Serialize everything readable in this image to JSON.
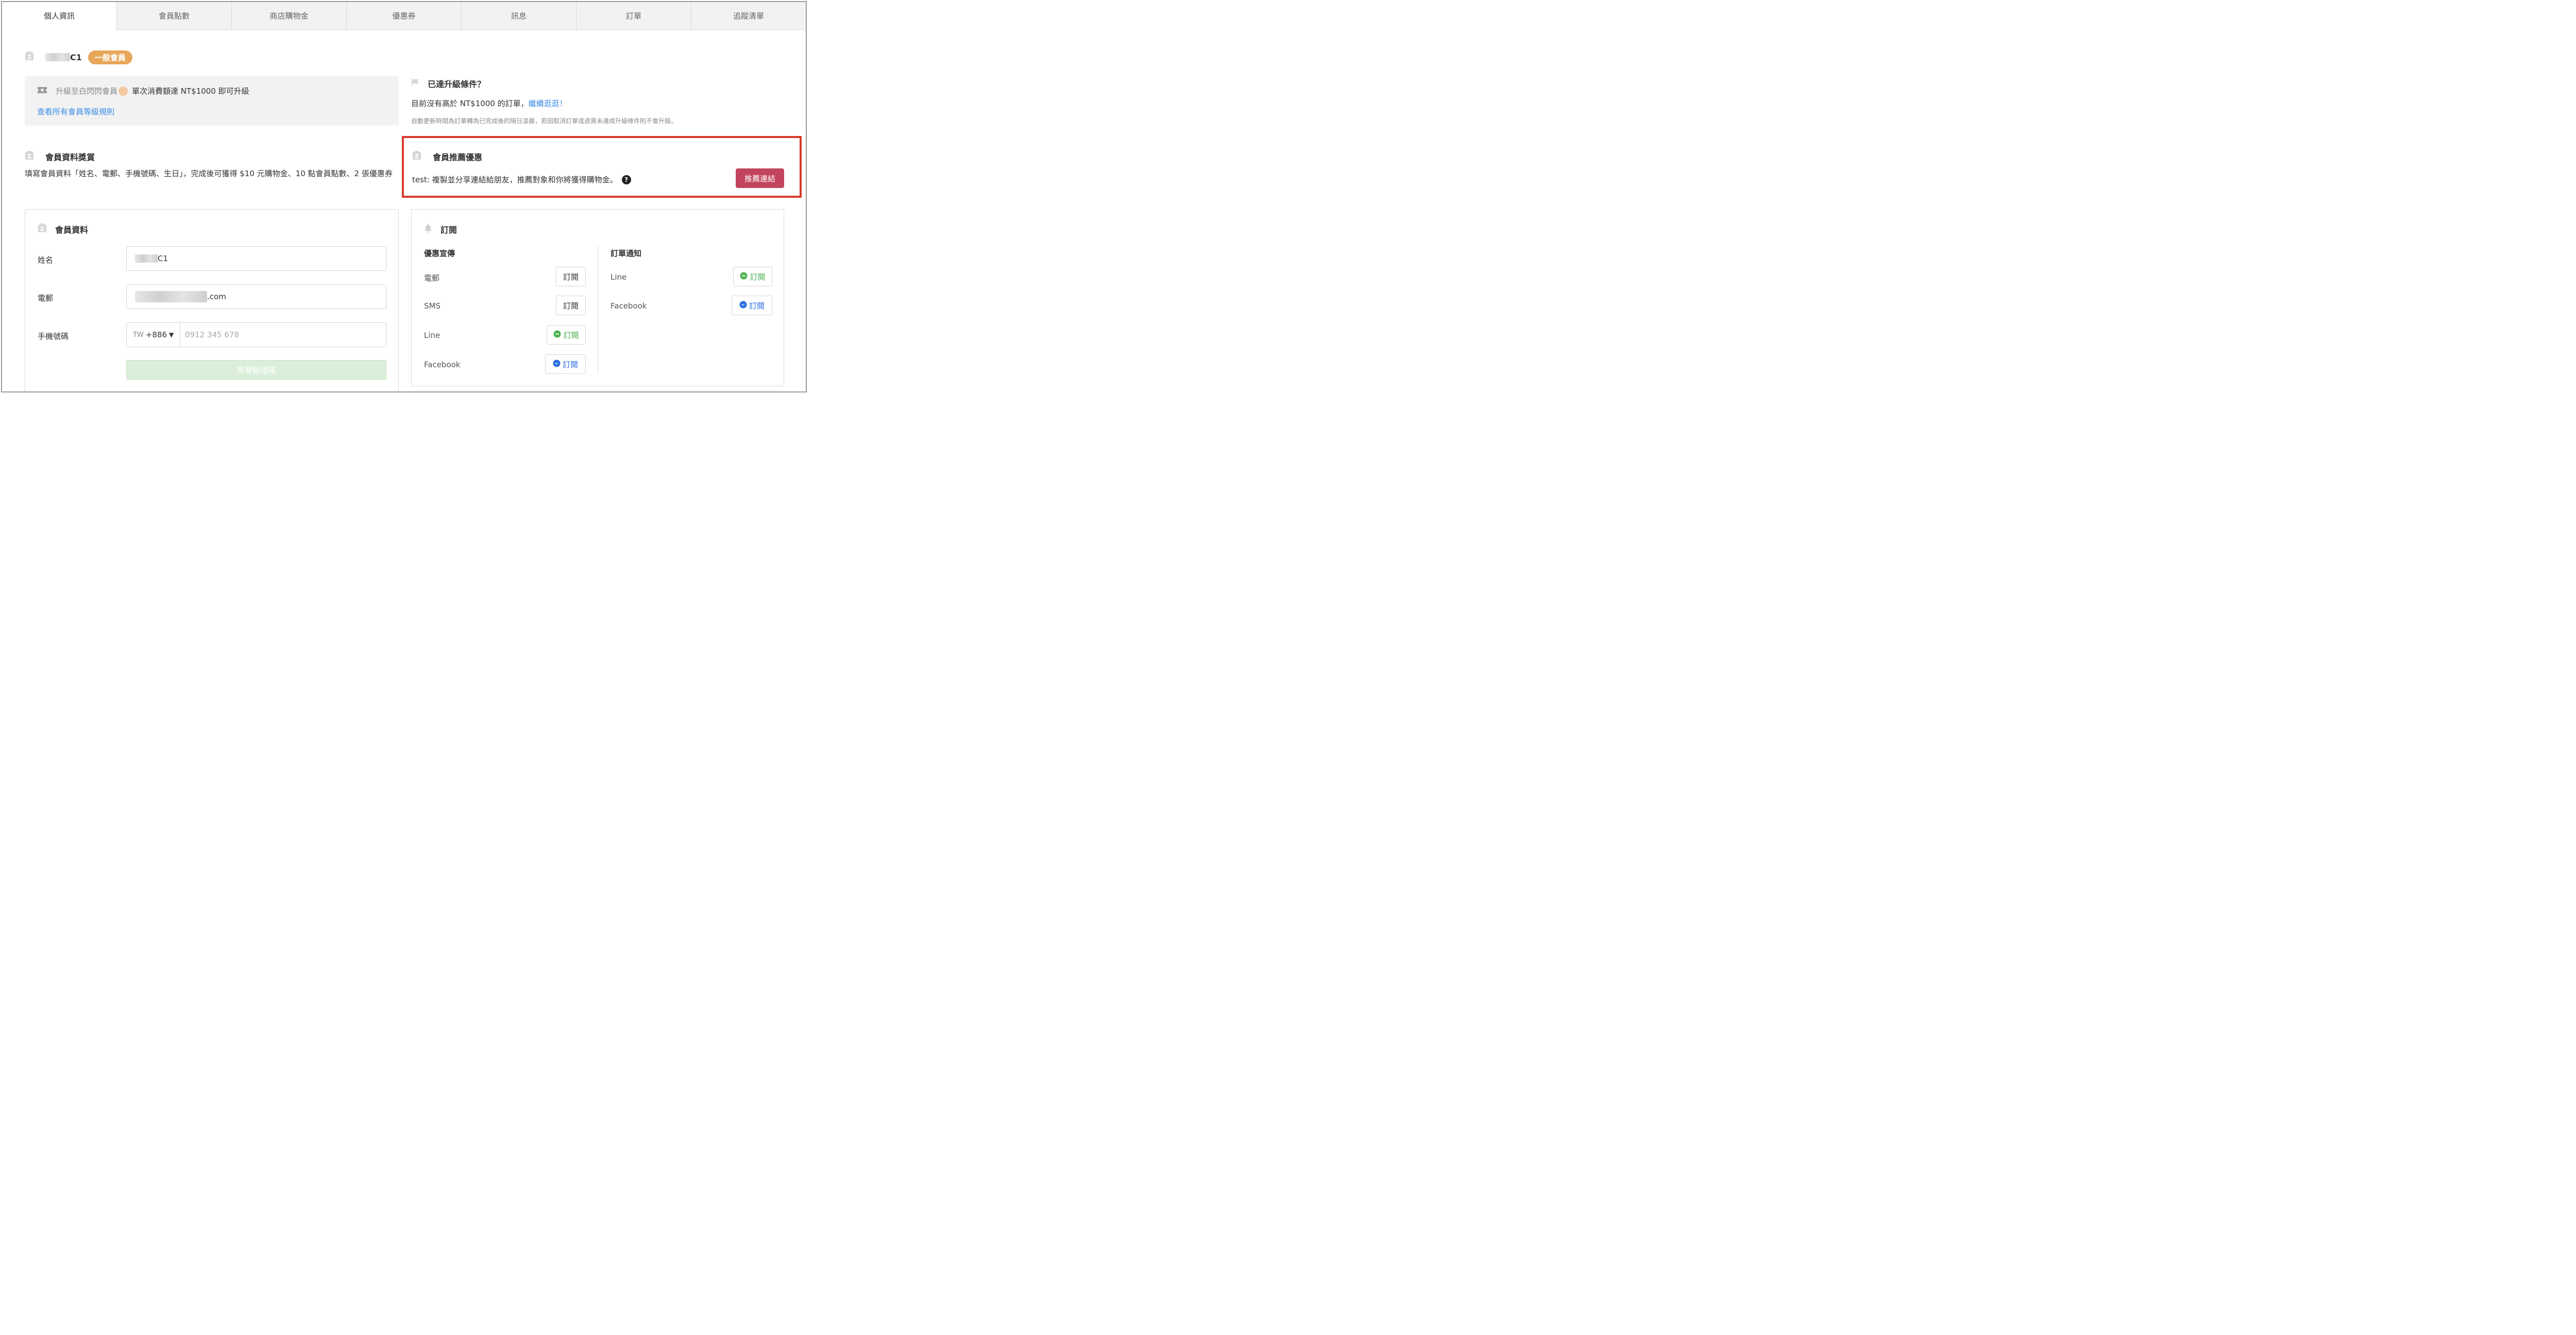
{
  "tabs": [
    "個人資訊",
    "會員點數",
    "商店購物金",
    "優惠券",
    "訊息",
    "訂單",
    "追蹤清單"
  ],
  "user": {
    "name_suffix": "C1",
    "tier_badge": "一般會員"
  },
  "upgrade": {
    "prefix": "升級至白閃閃會員",
    "condition": "單次消費額達 NT$1000 即可升級",
    "rules_link": "查看所有會員等級規則"
  },
  "condition_section": {
    "title": "已達升級條件？",
    "text": "目前沒有高於 NT$1000 的訂單，",
    "link": "繼續逛逛！",
    "note": "自動更新時間為訂單轉為已完成後的隔日凌晨，若因取消訂單或退貨未達成升級條件則不會升級。"
  },
  "reward": {
    "title": "會員資料獎賞",
    "text": "填寫會員資料「姓名、電郵、手機號碼、生日」，完成後可獲得 $10 元購物金、10 點會員點數、2 張優惠券"
  },
  "referral": {
    "title": "會員推薦優惠",
    "text": "test: 複製並分享連結給朋友，推薦對象和你將獲得購物金。",
    "button": "推薦連結"
  },
  "member_form": {
    "title": "會員資料",
    "name_label": "姓名",
    "name_value_suffix": "C1",
    "email_label": "電郵",
    "email_value_suffix": ".com",
    "phone_label": "手機號碼",
    "country_code": "TW",
    "dial_code": "+886",
    "phone_placeholder": "0912 345 678",
    "send_button": "寄發驗證碼"
  },
  "subscription": {
    "title": "訂閱",
    "promo_header": "優惠宣傳",
    "order_header": "訂單通知",
    "button_label": "訂閱",
    "promo_channels": [
      "電郵",
      "SMS",
      "Line",
      "Facebook"
    ],
    "order_channels": [
      "Line",
      "Facebook"
    ]
  },
  "colors": {
    "badge": "#e8a75a",
    "link": "#3a8ee6",
    "referral_border": "#d93b2b",
    "referral_button": "#c2445d",
    "send_button_bg": "#dbeed9",
    "line_green": "#4cb050",
    "messenger_blue": "#2d6fe0"
  }
}
